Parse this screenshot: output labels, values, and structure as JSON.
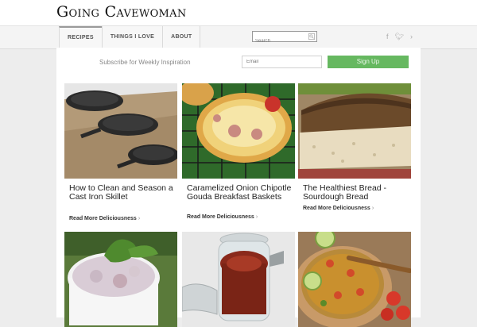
{
  "site": {
    "logo_text": "Going Cavewoman"
  },
  "nav": {
    "items": [
      {
        "label": "RECIPES"
      },
      {
        "label": "THINGS I LOVE"
      },
      {
        "label": "ABOUT"
      }
    ]
  },
  "search": {
    "placeholder": "Search"
  },
  "social": {
    "icons": [
      "facebook-icon",
      "twitter-icon",
      "rss-icon"
    ]
  },
  "subscribe": {
    "text": "Subscribe for Weekly Inspiration",
    "email_placeholder": "Email",
    "button_label": "Sign Up",
    "button_color": "#66b860"
  },
  "posts": [
    {
      "title": "How to Clean and Season a Cast Iron Skillet",
      "read_more": "Read More Deliciousness"
    },
    {
      "title": "Caramelized Onion Chipotle Gouda Breakfast Baskets",
      "read_more": "Read More Deliciousness"
    },
    {
      "title": "The Healthiest Bread - Sourdough Bread",
      "read_more": "Read More Deliciousness"
    },
    {
      "title": "",
      "read_more": ""
    },
    {
      "title": "",
      "read_more": ""
    },
    {
      "title": "",
      "read_more": ""
    }
  ]
}
